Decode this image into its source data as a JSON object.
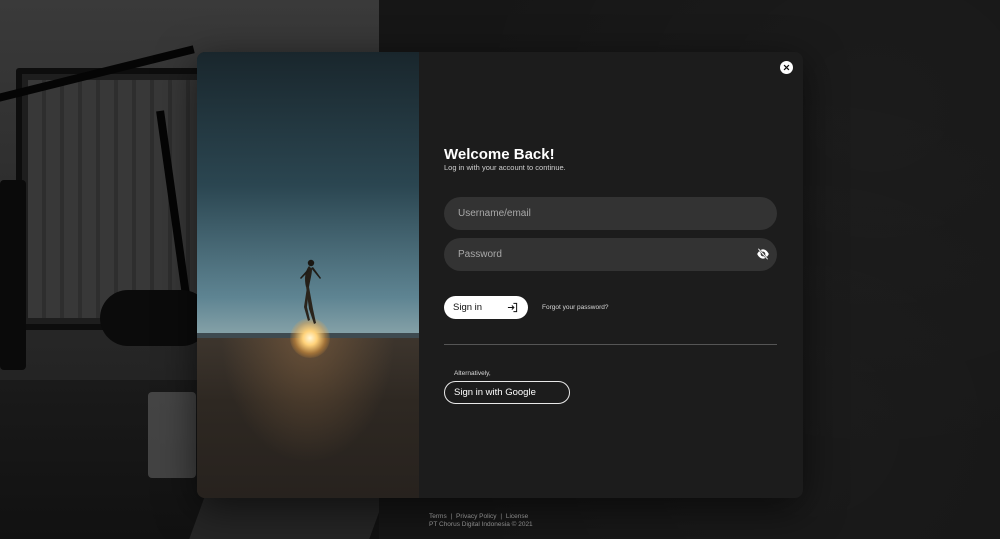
{
  "modal": {
    "title": "Welcome Back!",
    "subtitle": "Log in with your account to continue.",
    "username_placeholder": "Username/email",
    "password_placeholder": "Password",
    "signin_label": "Sign in",
    "forgot_label": "Forgot your password?",
    "alt_label": "Alternatively,",
    "google_label": "Sign in with Google"
  },
  "footer": {
    "links": [
      "Terms",
      "Privacy Policy",
      "License"
    ],
    "separator": "|",
    "copyright": "PT Chorus Digital Indonesia © 2021"
  },
  "icons": {
    "close": "close-icon",
    "password_toggle": "eye-off-icon",
    "signin": "enter-icon"
  },
  "colors": {
    "modal_bg": "#1c1c1c",
    "field_bg": "#333333",
    "button_bg": "#ffffff"
  }
}
